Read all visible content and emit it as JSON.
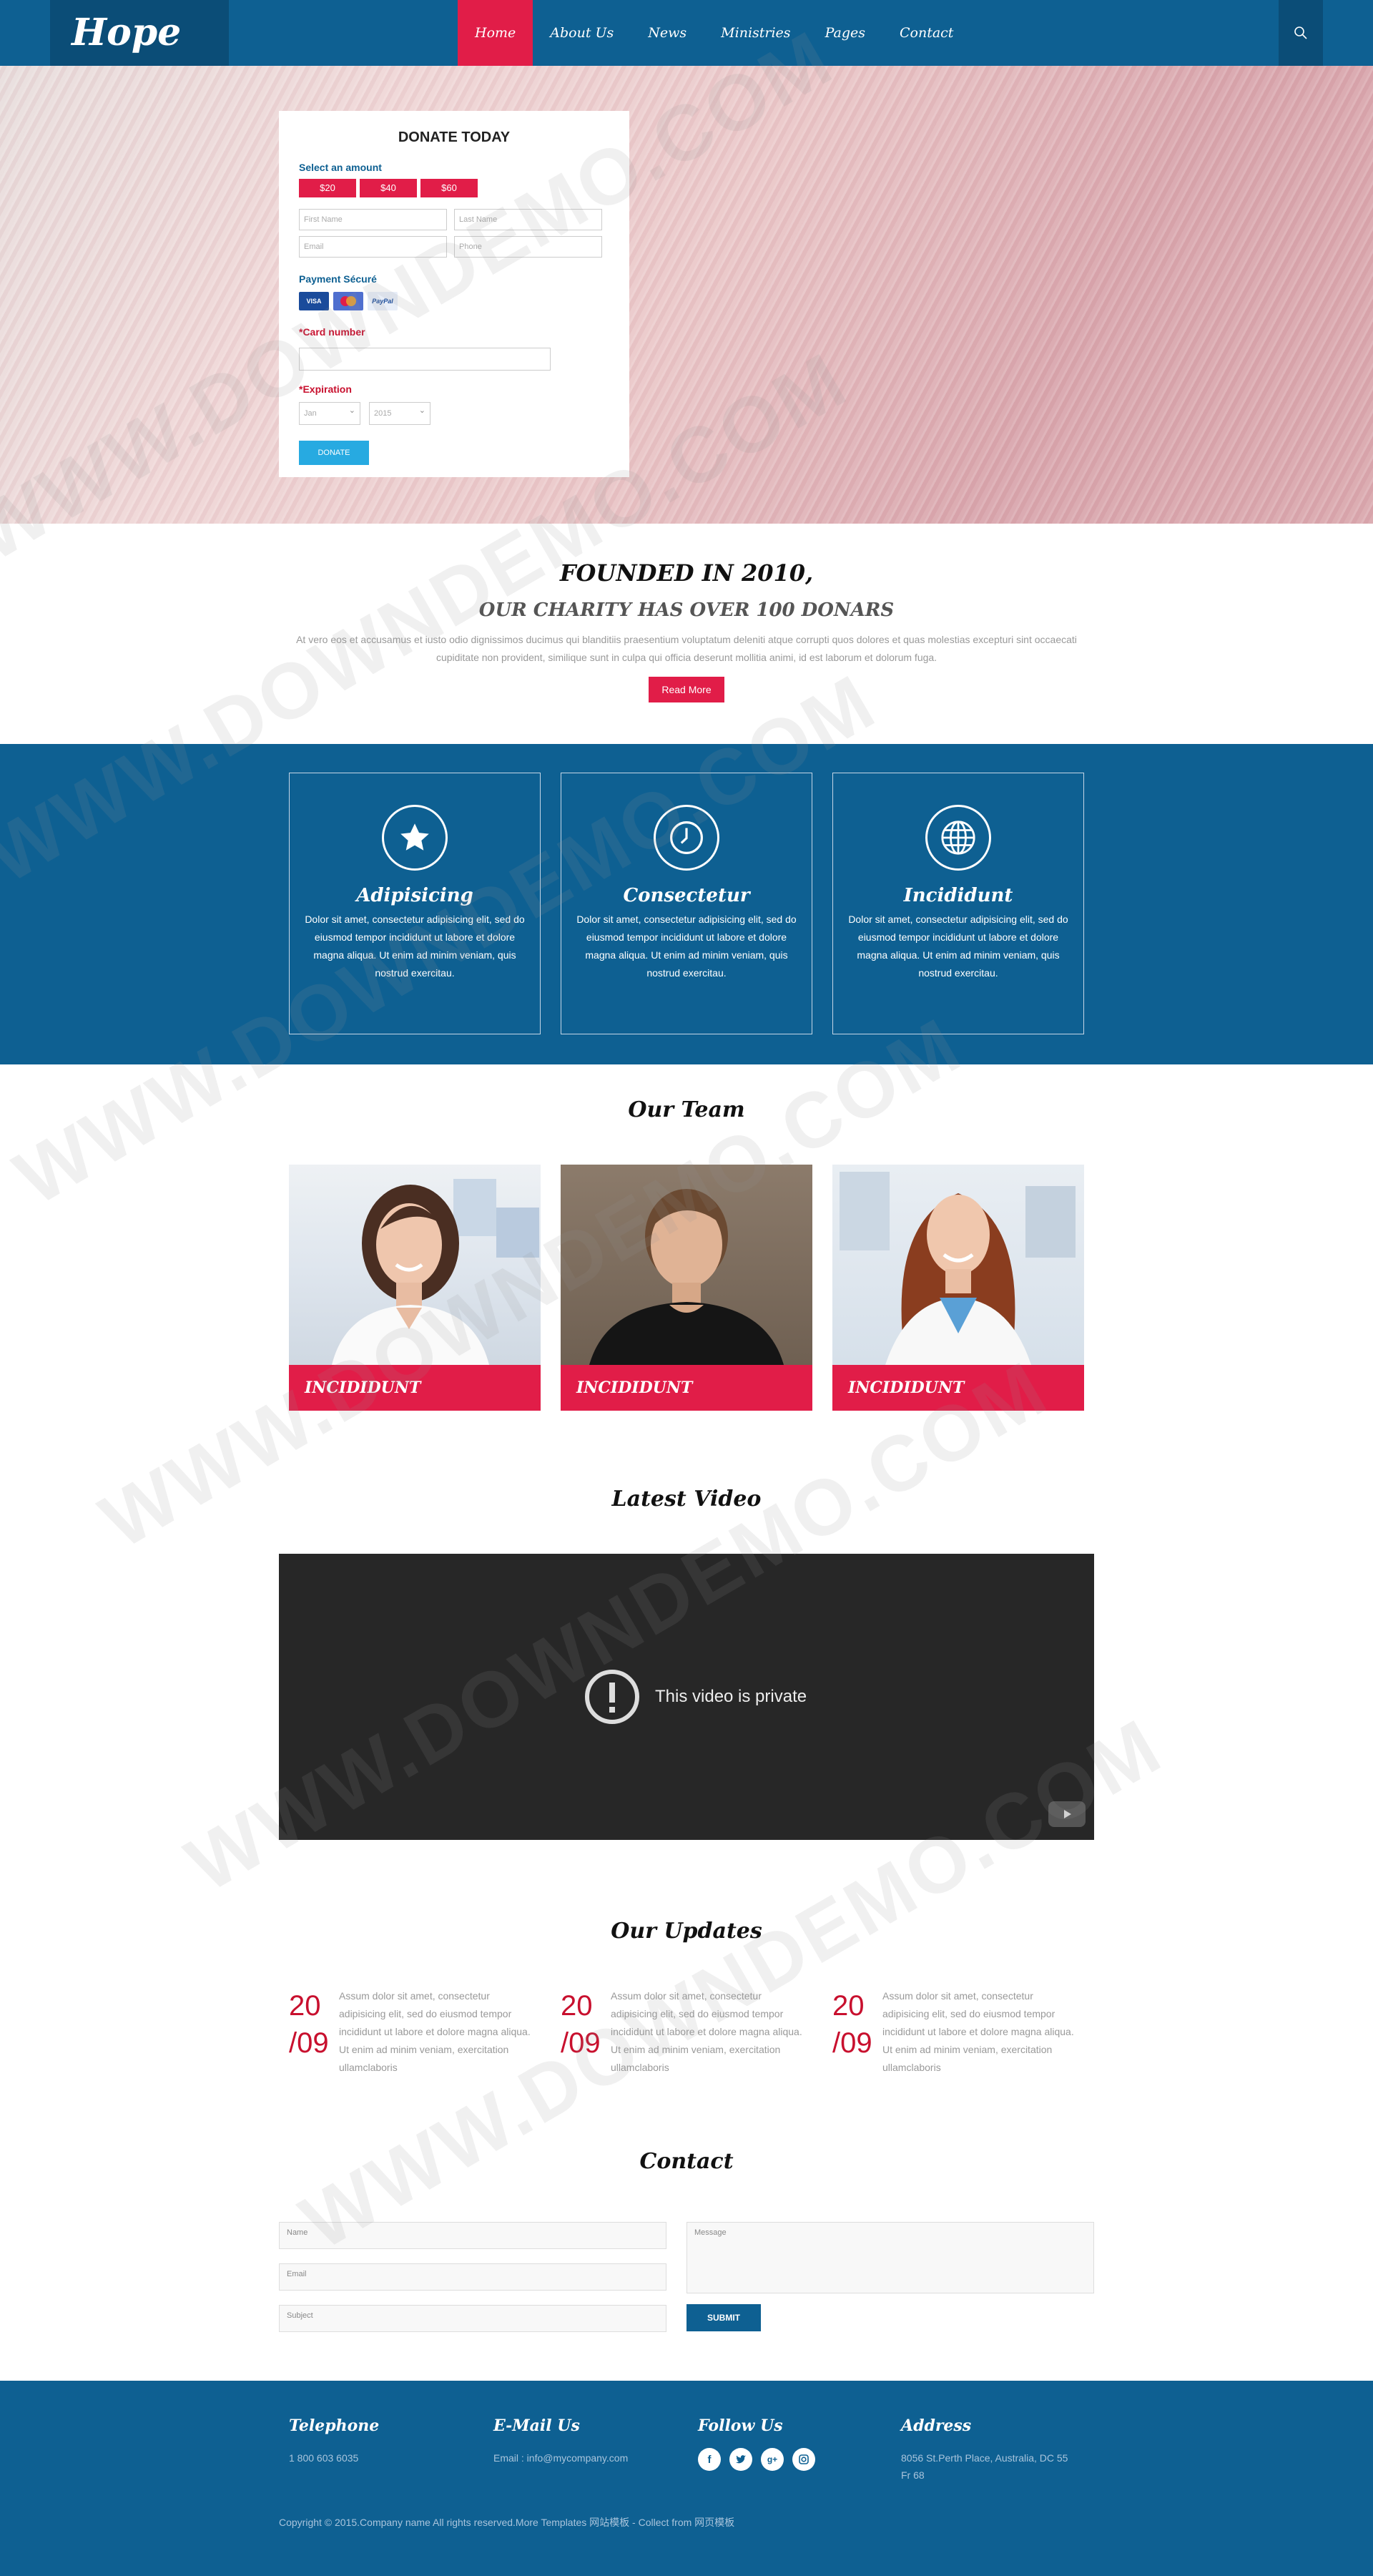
{
  "header": {
    "logo": "Hope",
    "nav": [
      "Home",
      "About Us",
      "News",
      "Ministries",
      "Pages",
      "Contact"
    ],
    "active_index": 0,
    "search_icon": "search-icon"
  },
  "donate": {
    "title": "DONATE TODAY",
    "select_amount": "Select an amount",
    "amounts": [
      "$20",
      "$40",
      "$60"
    ],
    "first_name": "First Name",
    "last_name": "Last Name",
    "email": "Email",
    "phone": "Phone",
    "payment_label": "Payment Sécuré",
    "cards": [
      "VISA",
      "MC",
      "PayPal"
    ],
    "card_number_label": "*Card number",
    "expiration_label": "*Expiration",
    "month": "Jan",
    "year": "2015",
    "button": "DONATE"
  },
  "founded": {
    "title": "FOUNDED IN 2010,",
    "subtitle": "OUR CHARITY HAS OVER 100 DONARS",
    "text": "At vero eos et accusamus et iusto odio dignissimos ducimus qui blanditiis praesentium voluptatum deleniti atque corrupti quos dolores et quas molestias excepturi sint occaecati cupiditate non provident, similique sunt in culpa qui officia deserunt mollitia animi, id est laborum et dolorum fuga.",
    "button": "Read More"
  },
  "features": [
    {
      "title": "Adipisicing",
      "icon": "star-icon",
      "text": "Dolor sit amet, consectetur adipisicing elit, sed do eiusmod tempor incididunt ut labore et dolore magna aliqua. Ut enim ad minim veniam, quis nostrud exercitau."
    },
    {
      "title": "Consectetur",
      "icon": "clock-icon",
      "text": "Dolor sit amet, consectetur adipisicing elit, sed do eiusmod tempor incididunt ut labore et dolore magna aliqua. Ut enim ad minim veniam, quis nostrud exercitau."
    },
    {
      "title": "Incididunt",
      "icon": "globe-icon",
      "text": "Dolor sit amet, consectetur adipisicing elit, sed do eiusmod tempor incididunt ut labore et dolore magna aliqua. Ut enim ad minim veniam, quis nostrud exercitau."
    }
  ],
  "team": {
    "title": "Our Team",
    "members": [
      {
        "name": "INCIDIDUNT"
      },
      {
        "name": "INCIDIDUNT"
      },
      {
        "name": "INCIDIDUNT"
      }
    ]
  },
  "video": {
    "title": "Latest Video",
    "message": "This video is private"
  },
  "updates": {
    "title": "Our Updates",
    "items": [
      {
        "day": "20",
        "month": "/09",
        "text": "Assum dolor sit amet, consectetur adipisicing elit, sed do eiusmod tempor incididunt ut labore et dolore magna aliqua. Ut enim ad minim veniam, exercitation ullamclaboris"
      },
      {
        "day": "20",
        "month": "/09",
        "text": "Assum dolor sit amet, consectetur adipisicing elit, sed do eiusmod tempor incididunt ut labore et dolore magna aliqua. Ut enim ad minim veniam, exercitation ullamclaboris"
      },
      {
        "day": "20",
        "month": "/09",
        "text": "Assum dolor sit amet, consectetur adipisicing elit, sed do eiusmod tempor incididunt ut labore et dolore magna aliqua. Ut enim ad minim veniam, exercitation ullamclaboris"
      }
    ]
  },
  "contact": {
    "title": "Contact",
    "name": "Name",
    "email": "Email",
    "subject": "Subject",
    "message": "Message",
    "button": "SUBMIT"
  },
  "footer": {
    "telephone_title": "Telephone",
    "telephone": "1 800 603 6035",
    "email_title": "E-Mail Us",
    "email": "Email : info@mycompany.com",
    "follow_title": "Follow Us",
    "socials": [
      "f",
      "t",
      "g+",
      "ig"
    ],
    "address_title": "Address",
    "address": "8056 St.Perth Place, Australia, DC 55 Fr 68",
    "copyright": "Copyright © 2015.Company name All rights reserved.More Templates 网站模板 - Collect from 网页模板"
  },
  "watermark": "WWW.DOWNDEMO.COM",
  "colors": {
    "primary": "#0e6092",
    "accent": "#e11d48",
    "donate_button": "#27aae1"
  }
}
